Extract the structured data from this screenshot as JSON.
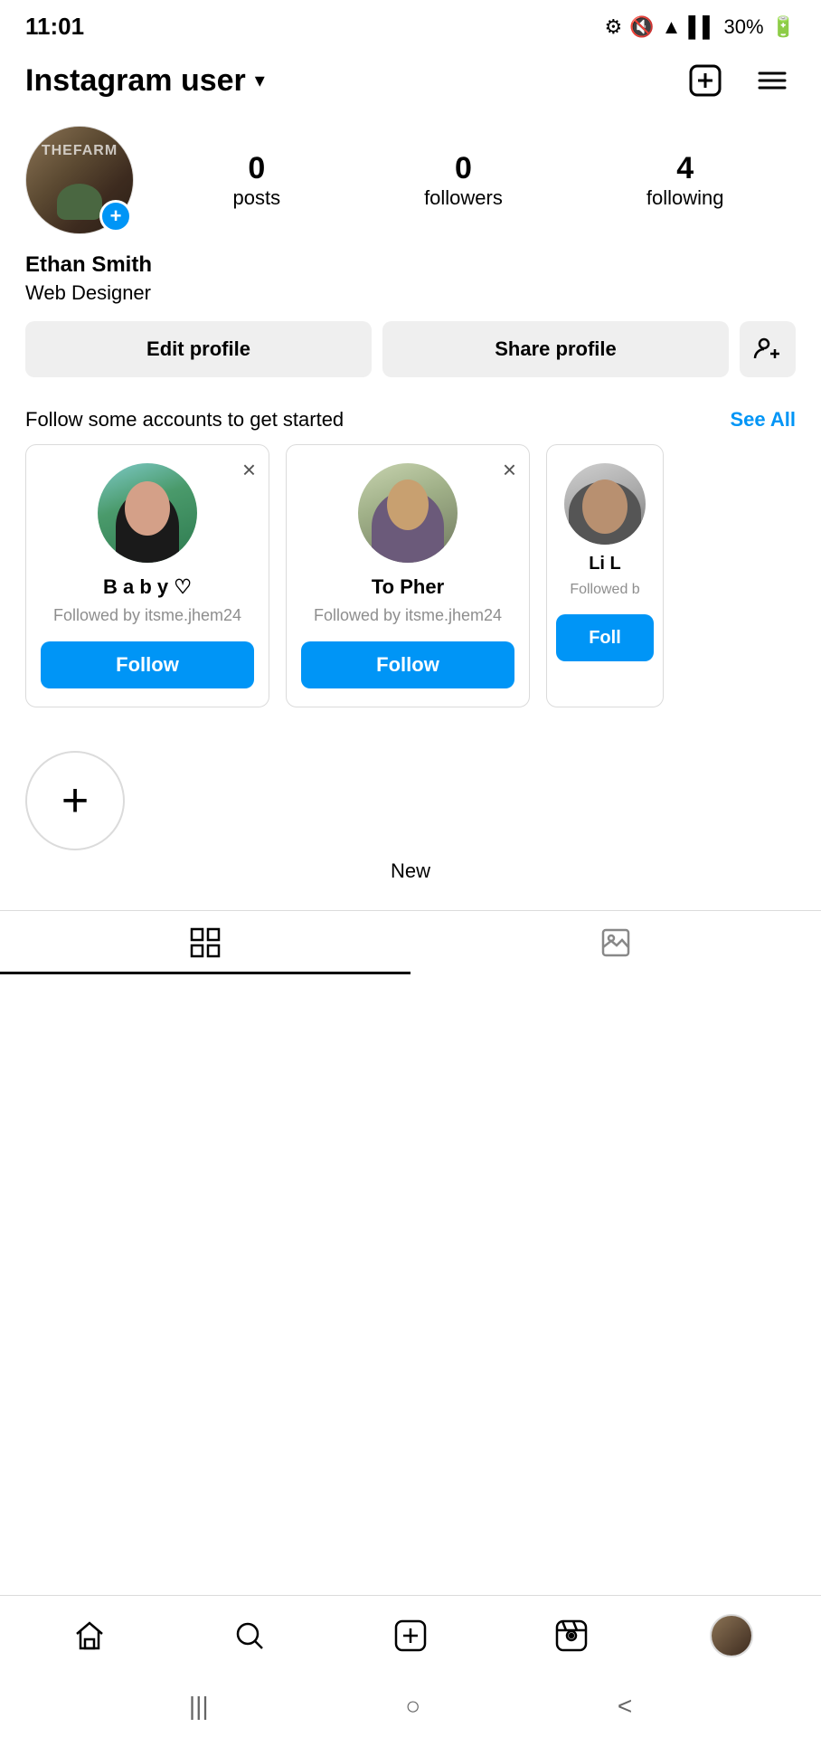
{
  "statusBar": {
    "time": "11:01",
    "battery": "30%"
  },
  "header": {
    "username": "Instagram user",
    "chevron": "▾",
    "addIcon": "+",
    "menuIcon": "≡"
  },
  "profile": {
    "name": "Ethan Smith",
    "bio": "Web Designer",
    "stats": {
      "posts": {
        "count": "0",
        "label": "posts"
      },
      "followers": {
        "count": "0",
        "label": "followers"
      },
      "following": {
        "count": "4",
        "label": "following"
      }
    },
    "addButton": "+",
    "editProfileLabel": "Edit profile",
    "shareProfileLabel": "Share profile"
  },
  "suggestions": {
    "title": "Follow some accounts to get started",
    "seeAllLabel": "See All",
    "cards": [
      {
        "username": "B a b y ♡",
        "followedBy": "Followed by itsme.jhem24",
        "followLabel": "Follow"
      },
      {
        "username": "To Pher",
        "followedBy": "Followed by itsme.jhem24",
        "followLabel": "Follow"
      },
      {
        "username": "Li L",
        "followedBy": "Followed b",
        "followLabel": "Foll"
      }
    ]
  },
  "newPost": {
    "icon": "+",
    "label": "New"
  },
  "tabs": {
    "grid": "grid",
    "tagged": "tagged"
  },
  "bottomNav": {
    "home": "home",
    "search": "search",
    "add": "add",
    "reels": "reels",
    "profile": "profile"
  },
  "androidNav": {
    "menu": "|||",
    "home": "○",
    "back": "<"
  }
}
